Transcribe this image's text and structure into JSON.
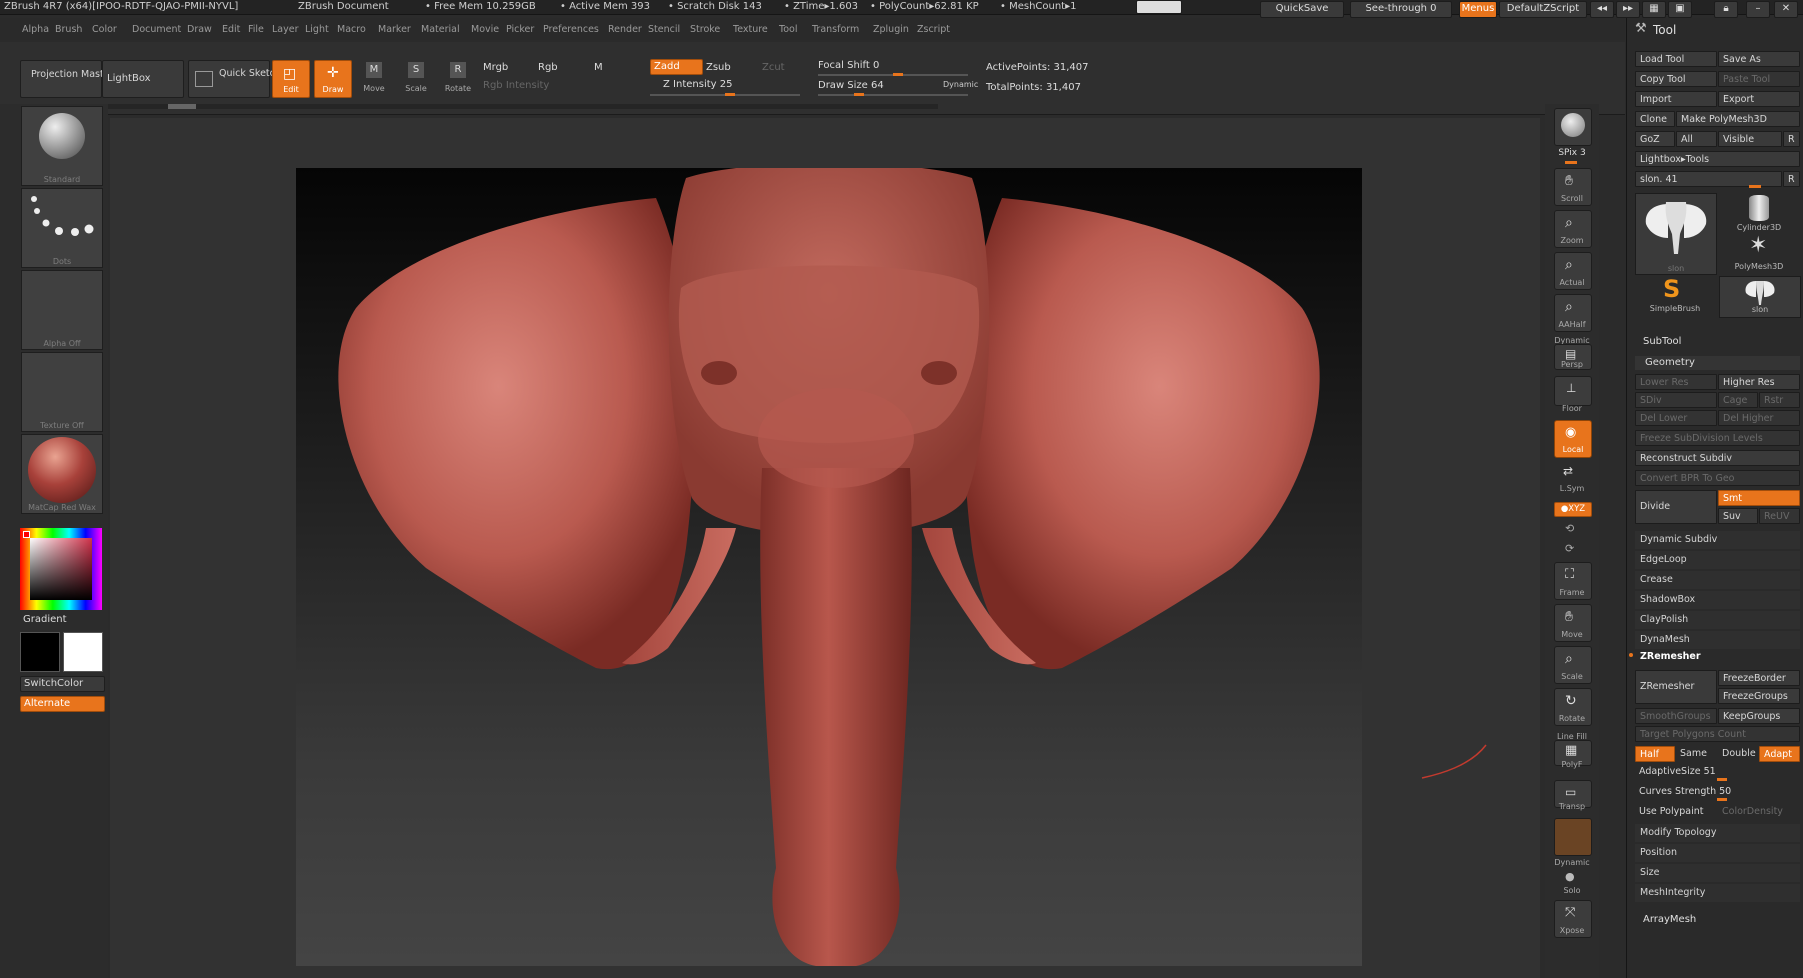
{
  "titlebar": {
    "app": "ZBrush 4R7 (x64)[IPOO-RDTF-QJAO-PMII-NYVL]",
    "document": "ZBrush Document",
    "free_mem": "• Free Mem 10.259GB",
    "active_mem": "• Active Mem 393",
    "scratch": "• Scratch Disk 143",
    "ztime": "• ZTime▸1.603",
    "polycount": "• PolyCount▸62.81  KP",
    "meshcount": "• MeshCount▸1",
    "quicksave": "QuickSave",
    "seethrough": "See-through   0",
    "menus": "Menus",
    "zscript": "DefaultZScript"
  },
  "menubar": [
    "Alpha",
    "Brush",
    "Color",
    "Document",
    "Draw",
    "Edit",
    "File",
    "Layer",
    "Light",
    "Macro",
    "Marker",
    "Material",
    "Movie",
    "Picker",
    "Preferences",
    "Render",
    "Stencil",
    "Stroke",
    "Texture",
    "Tool",
    "Transform",
    "Zplugin",
    "Zscript"
  ],
  "toolbar": {
    "projection_master": "Projection Master",
    "lightbox": "LightBox",
    "quick_sketch": "Quick Sketch",
    "edit": "Edit",
    "draw": "Draw",
    "move": "Move",
    "scale": "Scale",
    "rotate": "Rotate",
    "mrgb": "Mrgb",
    "rgb": "Rgb",
    "m": "M",
    "rgb_intensity": "Rgb Intensity",
    "zadd": "Zadd",
    "zsub": "Zsub",
    "zcut": "Zcut",
    "z_intensity": "Z Intensity 25",
    "focal_shift": "Focal Shift 0",
    "draw_size": "Draw Size 64",
    "dynamic": "Dynamic",
    "active_points": "ActivePoints: 31,407",
    "total_points": "TotalPoints: 31,407"
  },
  "leftshelf": {
    "brush": "Standard",
    "stroke": "Dots",
    "alpha": "Alpha  Off",
    "texture": "Texture  Off",
    "material": "MatCap Red Wax",
    "gradient": "Gradient",
    "switchcolor": "SwitchColor",
    "alternate": "Alternate"
  },
  "rightshelf": {
    "bpr": "BPR",
    "spix": "SPix 3",
    "scroll": "Scroll",
    "zoom": "Zoom",
    "actual": "Actual",
    "aahalf": "AAHalf",
    "dynamic": "Dynamic",
    "persp": "Persp",
    "floor": "Floor",
    "local": "Local",
    "lsym": "L.Sym",
    "xyz": "●XYZ",
    "frame": "Frame",
    "move": "Move",
    "scale": "Scale",
    "rotate": "Rotate",
    "linefill": "Line Fill",
    "polyf": "PolyF",
    "transp": "Transp",
    "dynamic2": "Dynamic",
    "solo": "Solo",
    "xpose": "Xpose"
  },
  "toolpanel": {
    "title": "Tool",
    "load_tool": "Load Tool",
    "save_as": "Save As",
    "copy_tool": "Copy Tool",
    "paste_tool": "Paste Tool",
    "import": "Import",
    "export": "Export",
    "clone": "Clone",
    "make_polymesh": "Make PolyMesh3D",
    "goz": "GoZ",
    "all": "All",
    "visible": "Visible",
    "r": "R",
    "lightbox_tools": "Lightbox▸Tools",
    "slon": "slon. 41",
    "r2": "R",
    "thumb_slon": "slon",
    "thumb_cyl": "Cylinder3D",
    "thumb_poly": "PolyMesh3D",
    "thumb_simple": "SimpleBrush",
    "thumb_slon2": "slon",
    "subtool": "SubTool",
    "geometry": "Geometry",
    "lower_res": "Lower Res",
    "higher_res": "Higher Res",
    "sdiv": "SDiv",
    "cage": "Cage",
    "rstr": "Rstr",
    "del_lower": "Del Lower",
    "del_higher": "Del Higher",
    "freeze_sub": "Freeze SubDivision Levels",
    "reconstruct": "Reconstruct Subdiv",
    "convert_bpr": "Convert BPR To Geo",
    "divide": "Divide",
    "smt": "Smt",
    "suv": "Suv",
    "reuv": "ReUV",
    "dynamic_subdiv": "Dynamic Subdiv",
    "edgeloop": "EdgeLoop",
    "crease": "Crease",
    "shadowbox": "ShadowBox",
    "claypolish": "ClayPolish",
    "dynamesh": "DynaMesh",
    "zremesher_section": "ZRemesher",
    "zremesher_btn": "ZRemesher",
    "freezeborder": "FreezeBorder",
    "freezegroups": "FreezeGroups",
    "smoothgroups": "SmoothGroups",
    "keepgroups": "KeepGroups",
    "target_poly": "Target Polygons Count",
    "half": "Half",
    "same": "Same",
    "double": "Double",
    "adapt": "Adapt",
    "adaptive_size": "AdaptiveSize 51",
    "curves_strength": "Curves Strength 50",
    "use_polypaint": "Use Polypaint",
    "color_density": "ColorDensity",
    "modify_topology": "Modify Topology",
    "position": "Position",
    "size": "Size",
    "meshintegrity": "MeshIntegrity",
    "arraymesh": "ArrayMesh"
  },
  "colors": {
    "accent": "#e8741c",
    "mesh": "#b8554c"
  }
}
